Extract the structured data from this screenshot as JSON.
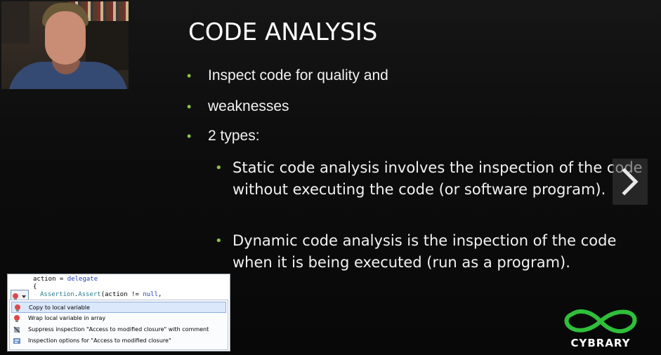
{
  "slide": {
    "title": "CODE ANALYSIS",
    "bullets": [
      "Inspect code for quality and",
      "weaknesses",
      "2 types:"
    ],
    "sub_bullets": [
      "Static code analysis involves the inspection of the code without executing the code (or software program).",
      "Dynamic code analysis is the inspection of the code when it is being executed (run as a program)."
    ],
    "bullet_glyph": "•",
    "accent_color": "#8bc34a"
  },
  "code_screenshot": {
    "code_lines": {
      "line1_var": "action",
      "line1_eq": " = ",
      "line1_kw": "delegate",
      "line2": "{",
      "line3_cls": "Assertion",
      "line3_dot": ".",
      "line3_fn": "Assert",
      "line3_args": "(action != ",
      "line3_kw": "null",
      "line3_end": ","
    },
    "menu_items": [
      {
        "label": "Copy to local variable",
        "icon": "bulb-icon"
      },
      {
        "label": "Wrap local variable in array",
        "icon": "bulb-icon"
      },
      {
        "label": "Suppress inspection \"Access to modified closure\" with comment",
        "icon": "suppress-icon"
      },
      {
        "label": "Inspection options for \"Access to modified closure\"",
        "icon": "options-icon"
      }
    ]
  },
  "logo": {
    "text": "CYBRARY",
    "color": "#2fbf3a"
  }
}
